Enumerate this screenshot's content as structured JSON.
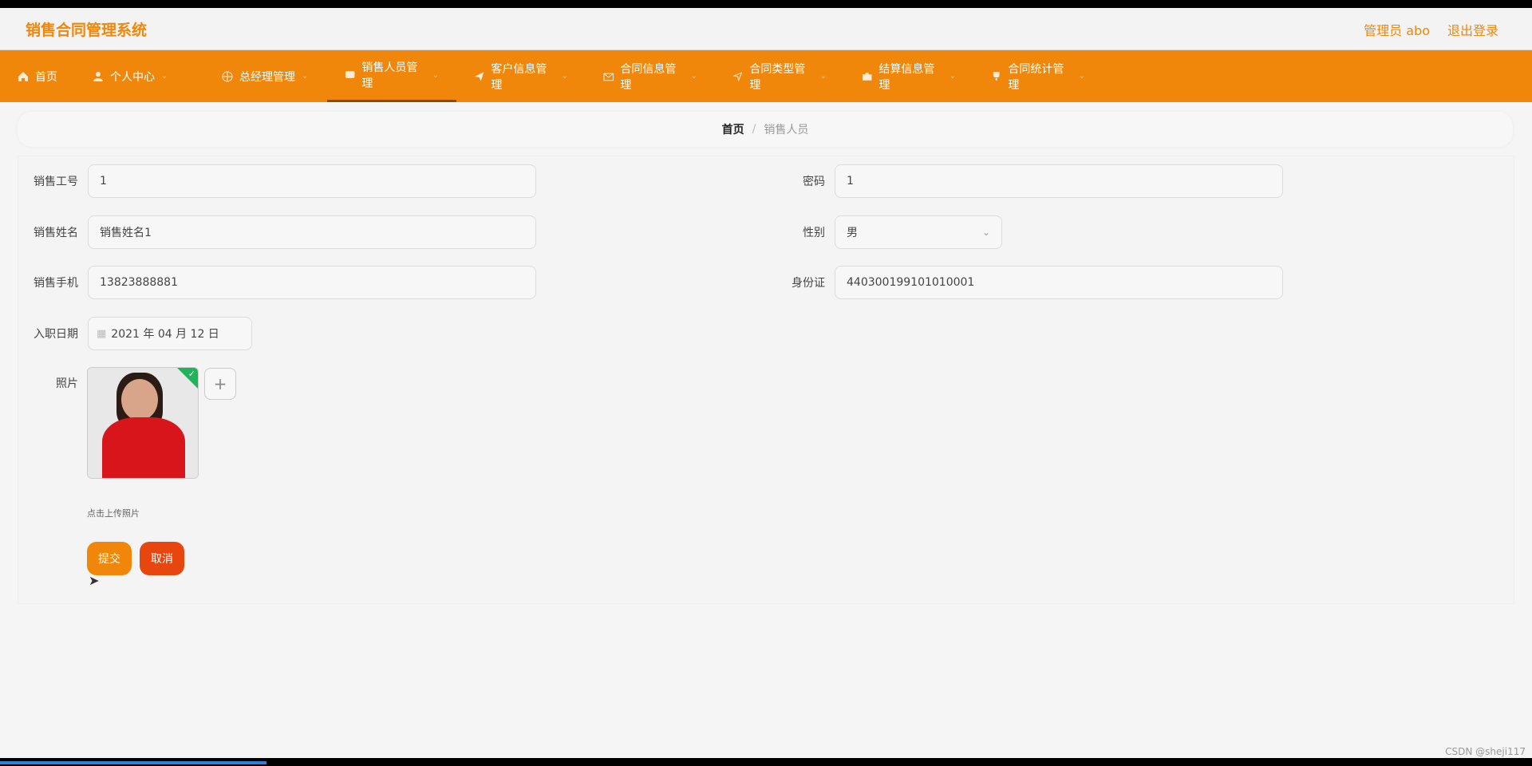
{
  "app": {
    "title": "销售合同管理系统"
  },
  "header": {
    "user": "管理员 abo",
    "logout": "退出登录"
  },
  "nav": [
    {
      "label": "首页",
      "icon": "home-icon"
    },
    {
      "label": "个人中心",
      "icon": "user-icon"
    },
    {
      "label": "总经理管理",
      "icon": "globe-icon"
    },
    {
      "label": "销售人员管理",
      "icon": "chat-icon"
    },
    {
      "label": "客户信息管理",
      "icon": "send-icon"
    },
    {
      "label": "合同信息管理",
      "icon": "mail-icon"
    },
    {
      "label": "合同类型管理",
      "icon": "location-icon"
    },
    {
      "label": "结算信息管理",
      "icon": "briefcase-icon"
    },
    {
      "label": "合同统计管理",
      "icon": "trophy-icon"
    }
  ],
  "breadcrumb": {
    "home": "首页",
    "separator": "/",
    "current": "销售人员"
  },
  "form": {
    "sales_id_label": "销售工号",
    "sales_id_value": "1",
    "password_label": "密码",
    "password_value": "1",
    "name_label": "销售姓名",
    "name_value": "销售姓名1",
    "gender_label": "性别",
    "gender_value": "男",
    "phone_label": "销售手机",
    "phone_value": "13823888881",
    "idcard_label": "身份证",
    "idcard_value": "440300199101010001",
    "date_label": "入职日期",
    "date_value": "2021 年 04 月 12 日",
    "photo_label": "照片",
    "upload_tip": "点击上传照片",
    "submit": "提交",
    "cancel": "取消"
  },
  "watermark": "CSDN @sheji117",
  "colors": {
    "accent": "#f0860a",
    "cancel": "#e8460f",
    "success": "#20b35a"
  }
}
